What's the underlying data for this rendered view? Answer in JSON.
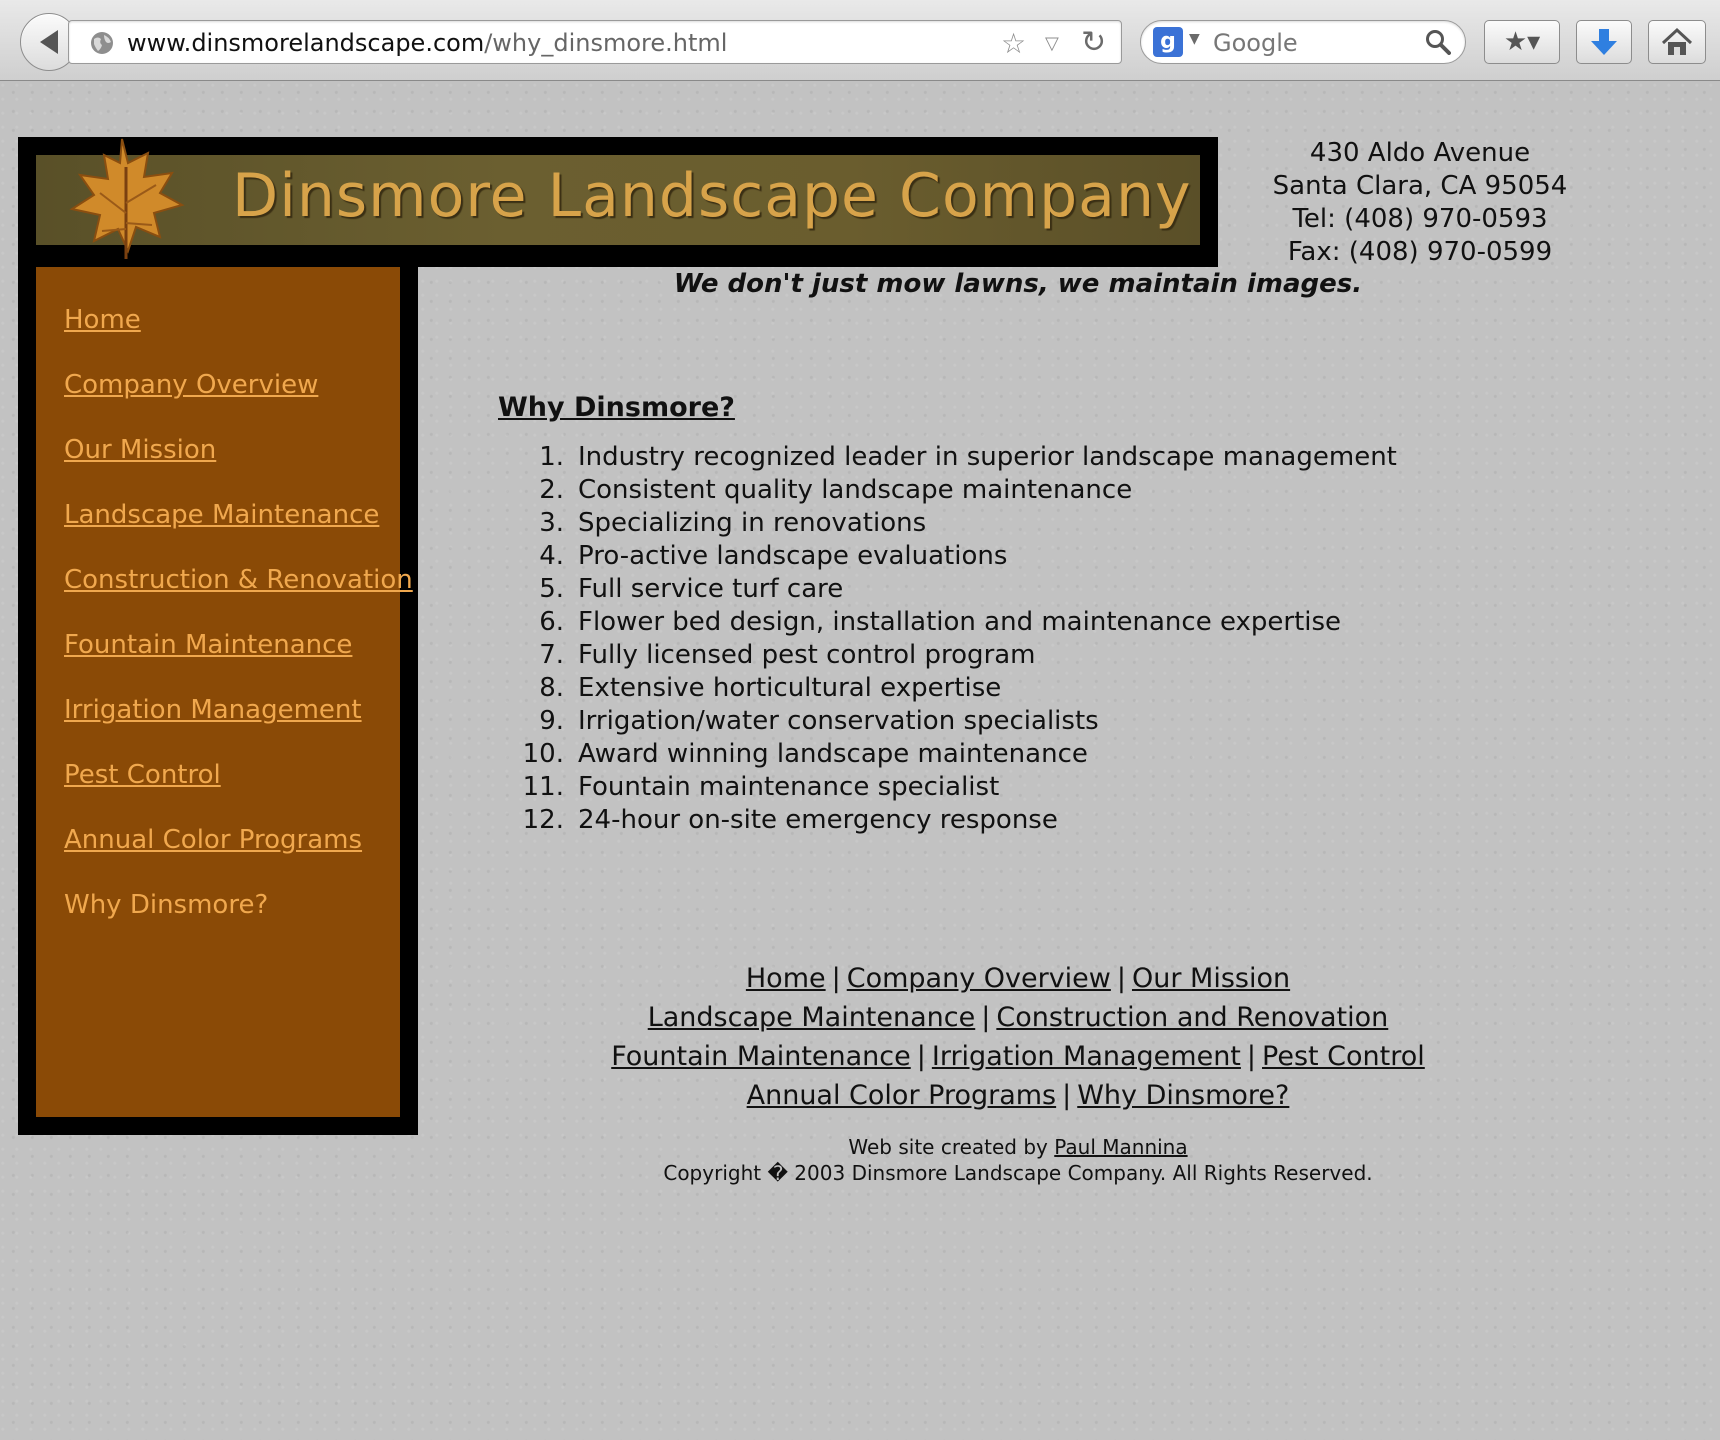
{
  "browser": {
    "url_host": "www.dinsmorelandscape.com",
    "url_path": "/why_dinsmore.html",
    "search_engine_icon": "g",
    "search_placeholder": "Google"
  },
  "header": {
    "company_name": "Dinsmore Landscape Company",
    "address_line1": "430 Aldo Avenue",
    "address_line2": "Santa Clara, CA 95054",
    "phone": "Tel: (408) 970-0593",
    "fax": "Fax: (408) 970-0599",
    "tagline": "We don't just mow lawns, we maintain images."
  },
  "sidebar": {
    "items": [
      {
        "label": "Home"
      },
      {
        "label": "Company Overview"
      },
      {
        "label": "Our Mission"
      },
      {
        "label": "Landscape Maintenance"
      },
      {
        "label": "Construction & Renovation"
      },
      {
        "label": "Fountain Maintenance"
      },
      {
        "label": "Irrigation Management"
      },
      {
        "label": "Pest Control"
      },
      {
        "label": "Annual Color Programs"
      },
      {
        "label": "Why Dinsmore?"
      }
    ]
  },
  "main": {
    "title": "Why Dinsmore?",
    "reasons": [
      "Industry recognized leader in superior landscape management",
      "Consistent quality landscape maintenance",
      "Specializing in renovations",
      "Pro-active landscape evaluations",
      "Full service turf care",
      "Flower bed design, installation and maintenance expertise",
      "Fully licensed pest control program",
      "Extensive horticultural expertise",
      "Irrigation/water conservation specialists",
      "Award winning landscape maintenance",
      "Fountain maintenance specialist",
      "24-hour on-site emergency response"
    ]
  },
  "footer": {
    "links": [
      "Home",
      "Company Overview",
      "Our Mission",
      "Landscape Maintenance",
      "Construction and Renovation",
      "Fountain Maintenance",
      "Irrigation Management",
      "Pest Control",
      "Annual Color Programs",
      "Why Dinsmore?"
    ],
    "credit_prefix": "Web site created by",
    "credit_name": "Paul Mannina",
    "copyright": "Copyright � 2003 Dinsmore Landscape Company. All Rights Reserved."
  },
  "colors": {
    "sidebar_bg": "#8a4a06",
    "link_orange": "#f0a84e",
    "banner_text": "#d7a34a",
    "page_bg": "#c2c2c2"
  }
}
